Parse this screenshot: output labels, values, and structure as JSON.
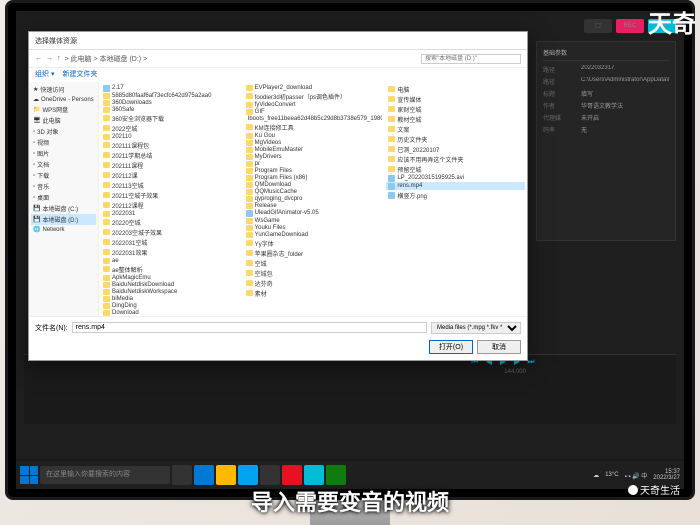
{
  "watermark": {
    "top": "天奇",
    "bottom": "天奇生活"
  },
  "subtitle": "导入需要变音的视频",
  "taskbar": {
    "search_placeholder": "在这里输入你要搜索的内容",
    "weather": "13°C",
    "time": "15:37",
    "date": "2022/3/27"
  },
  "panel": {
    "title": "基础参数",
    "rows": [
      {
        "label": "路径",
        "value": "2022032317"
      },
      {
        "label": "路径",
        "value": "C:\\Users\\Administrator\\AppData\\Local\\..."
      },
      {
        "label": "标题",
        "value": "填写"
      },
      {
        "label": "作者",
        "value": "华哥语文教学法"
      },
      {
        "label": "代理媒",
        "value": "未开启"
      },
      {
        "label": "码率",
        "value": "无"
      }
    ]
  },
  "timeline": {
    "time": "144,000"
  },
  "dialog": {
    "title": "选择媒体资源",
    "breadcrumb": [
      "此电脑",
      "本地磁盘 (D:)"
    ],
    "search_placeholder": "搜索\"本地磁盘 (D:)\"",
    "toolbar": [
      "组织 ▾",
      "新建文件夹"
    ],
    "sidebar": {
      "quick": "快速访问",
      "items": [
        "OneDrive - Persons",
        "WPS网盘",
        "此电脑",
        "3D 对象",
        "视频",
        "图片",
        "文档",
        "下载",
        "音乐",
        "桌面",
        "本地磁盘 (C:)",
        "本地磁盘 (D:)",
        "Network"
      ],
      "selected": "本地磁盘 (D:)"
    },
    "columns": [
      [
        "2.17",
        "5885d80faaf6af73ecfc642d975a2aa0",
        "360Downloads",
        "360Safe",
        "360安全浏览器下载",
        "2022空城",
        "202110",
        "202111课程包",
        "20211学期总结",
        "202111课程",
        "202112课",
        "202113空城",
        "20211空城子效果",
        "202112课程",
        "2022031",
        "20220空城",
        "202203空城子效果",
        "2022031空城",
        "2022031效果",
        "ae",
        "ae整体解析",
        "ApkMagicEmu",
        "BaiduNetdiskDownload",
        "BaiduNetdiskWorkspace",
        "biMedia",
        "DingDing",
        "Download"
      ],
      [
        "EVPlayer2_download",
        "foodier3d初passer（ps调色插件）",
        "fyVideoConvert",
        "GIF",
        "Iboots_free11beea62d48b5c29d8b3738e579_198000",
        "KM连接修工具",
        "Ku Gou",
        "MgVideos",
        "MobileEmuMaster",
        "MyDrivers",
        "pr",
        "Program Files",
        "Program Files (x86)",
        "QMDownload",
        "QQMusicCache",
        "qyproging_dvcpro",
        "Release",
        "UleadGifAnimator-v5.05",
        "WsGame",
        "Youku Files",
        "YunGameDownload",
        "Yy字体",
        "苹果圈杂志_folder",
        "空城",
        "空城包",
        "达芬奇",
        "素材"
      ],
      [
        "电脑",
        "宣传媒体",
        "家财空城",
        "教材空城",
        "文案",
        "历史文件夹",
        "已测_20220107",
        "应该不用再弄这个文件夹",
        "预留空城",
        "LP_20220315195925.avi",
        "rens.mp4",
        "横竖方.png"
      ]
    ],
    "selected_file": "rens.mp4",
    "filename_label": "文件名(N):",
    "filename_value": "rens.mp4",
    "filter": "Media files (*.mpg *.fkv *.mo...",
    "open_btn": "打开(O)",
    "cancel_btn": "取消"
  }
}
